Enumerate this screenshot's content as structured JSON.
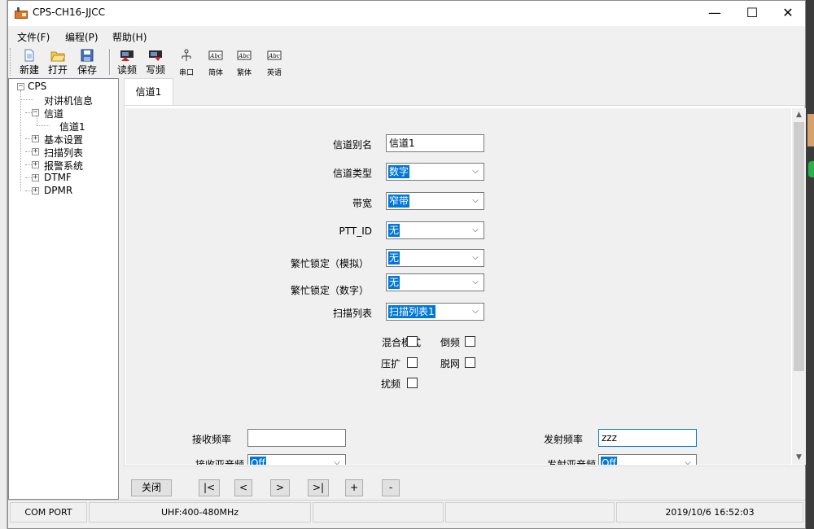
{
  "window": {
    "title": "CPS-CH16-JJCC",
    "minimize_glyph": "—",
    "maximize_glyph": "☐",
    "close_glyph": "✕"
  },
  "menu": [
    "文件(F)",
    "编程(P)",
    "帮助(H)"
  ],
  "toolbar": [
    {
      "label": "新建",
      "icon": "new-file-icon"
    },
    {
      "label": "打开",
      "icon": "open-folder-icon"
    },
    {
      "label": "保存",
      "icon": "save-disk-icon"
    },
    {
      "label": "读频",
      "icon": "read-radio-icon"
    },
    {
      "label": "写频",
      "icon": "write-radio-icon"
    },
    {
      "label": "串口",
      "icon": "serial-port-icon"
    },
    {
      "label": "简体",
      "icon": "simplified-chinese-icon"
    },
    {
      "label": "繁体",
      "icon": "traditional-chinese-icon"
    },
    {
      "label": "英语",
      "icon": "english-icon"
    }
  ],
  "tree": {
    "root": "CPS",
    "items": [
      {
        "label": "对讲机信息"
      },
      {
        "label": "信道",
        "expanded": true
      },
      {
        "label": "信道1"
      },
      {
        "label": "基本设置"
      },
      {
        "label": "扫描列表"
      },
      {
        "label": "报警系统"
      },
      {
        "label": "DTMF"
      },
      {
        "label": "DPMR"
      }
    ],
    "expand_glyph": "+",
    "collapse_glyph": "−"
  },
  "tab": {
    "label": "信道1"
  },
  "form": {
    "alias_label": "信道别名",
    "alias_value": "信道1",
    "type_label": "信道类型",
    "type_value": "数字",
    "bandwidth_label": "带宽",
    "bandwidth_value": "窄带",
    "ptt_label": "PTT_ID",
    "ptt_value": "无",
    "busy_analog_label": "繁忙锁定（模拟）",
    "busy_analog_value": "无",
    "busy_digital_label": "繁忙锁定（数字）",
    "busy_digital_value": "无",
    "scan_label": "扫描列表",
    "scan_value": "扫描列表1",
    "mixed_label": "混合模式",
    "reverse_label": "倒频",
    "compand_label": "压扩",
    "offnet_label": "脱网",
    "scramble_label": "扰频",
    "rx_freq_label": "接收频率",
    "rx_freq_value": "",
    "tx_freq_label": "发射频率",
    "tx_freq_value": "zzz",
    "rx_tone_label": "接收亚音频",
    "rx_tone_value": "Off",
    "tx_tone_label": "发射亚音频",
    "tx_tone_value": "Off"
  },
  "nav": {
    "close": "关闭",
    "first": "|<",
    "prev": "<",
    "next": ">",
    "last": ">|",
    "add": "+",
    "remove": "-"
  },
  "status": {
    "port": "COM PORT",
    "band": "UHF:400-480MHz",
    "empty1": "",
    "empty2": "",
    "datetime": "2019/10/6 16:52:03"
  },
  "scroll_glyphs": {
    "up": "▲",
    "down": "▼",
    "combo": "⌵"
  }
}
